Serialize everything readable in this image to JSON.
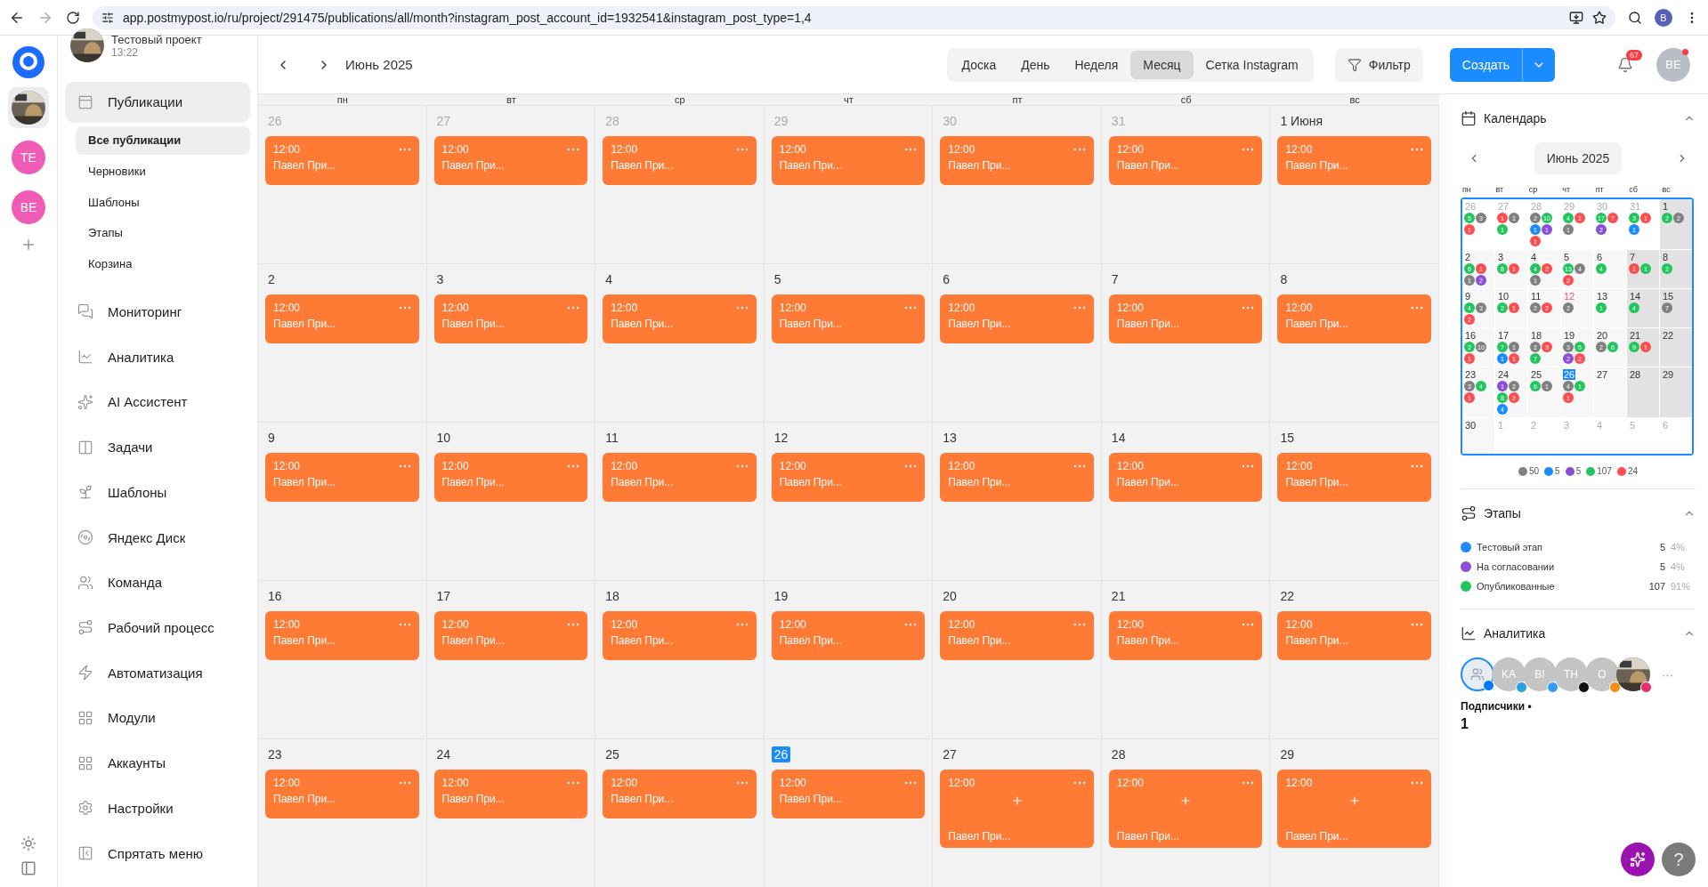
{
  "browser": {
    "url": "app.postmypost.io/ru/project/291475/publications/all/month?instagram_post_account_id=1932541&instagram_post_type=1,4",
    "profile": "B"
  },
  "rail": {
    "accounts": [
      {
        "kind": "picture",
        "selected": true
      },
      {
        "kind": "initials",
        "label": "TE",
        "selected": false
      },
      {
        "kind": "initials",
        "label": "BE",
        "selected": false
      }
    ]
  },
  "project": {
    "name": "Тестовый проект",
    "time": "13:22"
  },
  "sidebar": {
    "items": [
      {
        "label": "Публикации",
        "selected": true,
        "children": [
          {
            "label": "Все публикации",
            "selected": true
          },
          {
            "label": "Черновики",
            "selected": false
          },
          {
            "label": "Шаблоны",
            "selected": false
          },
          {
            "label": "Этапы",
            "selected": false
          },
          {
            "label": "Корзина",
            "selected": false
          }
        ]
      },
      {
        "label": "Мониторинг",
        "selected": false
      },
      {
        "label": "Аналитика",
        "selected": false
      },
      {
        "label": "AI Ассистент",
        "selected": false
      },
      {
        "label": "Задачи",
        "selected": false
      },
      {
        "label": "Шаблоны",
        "selected": false
      },
      {
        "label": "Яндекс Диск",
        "selected": false
      },
      {
        "label": "Команда",
        "selected": false
      },
      {
        "label": "Рабочий процесс",
        "selected": false
      },
      {
        "label": "Автоматизация",
        "selected": false
      },
      {
        "label": "Модули",
        "selected": false
      },
      {
        "label": "Аккаунты",
        "selected": false
      },
      {
        "label": "Настройки",
        "selected": false
      },
      {
        "label": "Спрятать меню",
        "selected": false
      }
    ]
  },
  "header": {
    "month": "Июнь 2025",
    "views": [
      {
        "label": "Доска",
        "selected": false
      },
      {
        "label": "День",
        "selected": false
      },
      {
        "label": "Неделя",
        "selected": false
      },
      {
        "label": "Месяц",
        "selected": true
      },
      {
        "label": "Сетка Instagram",
        "selected": false
      }
    ],
    "filter": "Фильтр",
    "create": "Создать",
    "notifications": "67",
    "user": "BE"
  },
  "calendar": {
    "weekdays": [
      "пн",
      "вт",
      "ср",
      "чт",
      "пт",
      "сб",
      "вс"
    ],
    "weeks": [
      [
        {
          "day": "26",
          "muted": true,
          "today": false,
          "posts": [
            {
              "time": "12:00",
              "title": "Павел При...",
              "add": false
            }
          ]
        },
        {
          "day": "27",
          "muted": true,
          "today": false,
          "posts": [
            {
              "time": "12:00",
              "title": "Павел При...",
              "add": false
            }
          ]
        },
        {
          "day": "28",
          "muted": true,
          "today": false,
          "posts": [
            {
              "time": "12:00",
              "title": "Павел При...",
              "add": false
            }
          ]
        },
        {
          "day": "29",
          "muted": true,
          "today": false,
          "posts": [
            {
              "time": "12:00",
              "title": "Павел При...",
              "add": false
            }
          ]
        },
        {
          "day": "30",
          "muted": true,
          "today": false,
          "posts": [
            {
              "time": "12:00",
              "title": "Павел При...",
              "add": false
            }
          ]
        },
        {
          "day": "31",
          "muted": true,
          "today": false,
          "posts": [
            {
              "time": "12:00",
              "title": "Павел При...",
              "add": false
            }
          ]
        },
        {
          "day": "1 Июня",
          "muted": false,
          "today": false,
          "posts": [
            {
              "time": "12:00",
              "title": "Павел При...",
              "add": false
            }
          ]
        }
      ],
      [
        {
          "day": "2",
          "muted": false,
          "today": false,
          "posts": [
            {
              "time": "12:00",
              "title": "Павел При...",
              "add": false
            }
          ]
        },
        {
          "day": "3",
          "muted": false,
          "today": false,
          "posts": [
            {
              "time": "12:00",
              "title": "Павел При...",
              "add": false
            }
          ]
        },
        {
          "day": "4",
          "muted": false,
          "today": false,
          "posts": [
            {
              "time": "12:00",
              "title": "Павел При...",
              "add": false
            }
          ]
        },
        {
          "day": "5",
          "muted": false,
          "today": false,
          "posts": [
            {
              "time": "12:00",
              "title": "Павел При...",
              "add": false
            }
          ]
        },
        {
          "day": "6",
          "muted": false,
          "today": false,
          "posts": [
            {
              "time": "12:00",
              "title": "Павел При...",
              "add": false
            }
          ]
        },
        {
          "day": "7",
          "muted": false,
          "today": false,
          "posts": [
            {
              "time": "12:00",
              "title": "Павел При...",
              "add": false
            }
          ]
        },
        {
          "day": "8",
          "muted": false,
          "today": false,
          "posts": [
            {
              "time": "12:00",
              "title": "Павел При...",
              "add": false
            }
          ]
        }
      ],
      [
        {
          "day": "9",
          "muted": false,
          "today": false,
          "posts": [
            {
              "time": "12:00",
              "title": "Павел При...",
              "add": false
            }
          ]
        },
        {
          "day": "10",
          "muted": false,
          "today": false,
          "posts": [
            {
              "time": "12:00",
              "title": "Павел При...",
              "add": false
            }
          ]
        },
        {
          "day": "11",
          "muted": false,
          "today": false,
          "posts": [
            {
              "time": "12:00",
              "title": "Павел При...",
              "add": false
            }
          ]
        },
        {
          "day": "12",
          "muted": false,
          "today": false,
          "posts": [
            {
              "time": "12:00",
              "title": "Павел При...",
              "add": false
            }
          ]
        },
        {
          "day": "13",
          "muted": false,
          "today": false,
          "posts": [
            {
              "time": "12:00",
              "title": "Павел При...",
              "add": false
            }
          ]
        },
        {
          "day": "14",
          "muted": false,
          "today": false,
          "posts": [
            {
              "time": "12:00",
              "title": "Павел При...",
              "add": false
            }
          ]
        },
        {
          "day": "15",
          "muted": false,
          "today": false,
          "posts": [
            {
              "time": "12:00",
              "title": "Павел При...",
              "add": false
            }
          ]
        }
      ],
      [
        {
          "day": "16",
          "muted": false,
          "today": false,
          "posts": [
            {
              "time": "12:00",
              "title": "Павел При...",
              "add": false
            }
          ]
        },
        {
          "day": "17",
          "muted": false,
          "today": false,
          "posts": [
            {
              "time": "12:00",
              "title": "Павел При...",
              "add": false
            }
          ]
        },
        {
          "day": "18",
          "muted": false,
          "today": false,
          "posts": [
            {
              "time": "12:00",
              "title": "Павел При...",
              "add": false
            }
          ]
        },
        {
          "day": "19",
          "muted": false,
          "today": false,
          "posts": [
            {
              "time": "12:00",
              "title": "Павел При...",
              "add": false
            }
          ]
        },
        {
          "day": "20",
          "muted": false,
          "today": false,
          "posts": [
            {
              "time": "12:00",
              "title": "Павел При...",
              "add": false
            }
          ]
        },
        {
          "day": "21",
          "muted": false,
          "today": false,
          "posts": [
            {
              "time": "12:00",
              "title": "Павел При...",
              "add": false
            }
          ]
        },
        {
          "day": "22",
          "muted": false,
          "today": false,
          "posts": [
            {
              "time": "12:00",
              "title": "Павел При...",
              "add": false
            }
          ]
        }
      ],
      [
        {
          "day": "23",
          "muted": false,
          "today": false,
          "posts": [
            {
              "time": "12:00",
              "title": "Павел При...",
              "add": false
            }
          ]
        },
        {
          "day": "24",
          "muted": false,
          "today": false,
          "posts": [
            {
              "time": "12:00",
              "title": "Павел При...",
              "add": false
            }
          ]
        },
        {
          "day": "25",
          "muted": false,
          "today": false,
          "posts": [
            {
              "time": "12:00",
              "title": "Павел При...",
              "add": false
            }
          ]
        },
        {
          "day": "26",
          "muted": false,
          "today": true,
          "posts": [
            {
              "time": "12:00",
              "title": "Павел При...",
              "add": false
            }
          ]
        },
        {
          "day": "27",
          "muted": false,
          "today": false,
          "posts": [
            {
              "time": "12:00",
              "title": "Павел При...",
              "add": true
            }
          ]
        },
        {
          "day": "28",
          "muted": false,
          "today": false,
          "posts": [
            {
              "time": "12:00",
              "title": "Павел При...",
              "add": true
            }
          ]
        },
        {
          "day": "29",
          "muted": false,
          "today": false,
          "posts": [
            {
              "time": "12:00",
              "title": "Павел При...",
              "add": true
            }
          ]
        }
      ]
    ]
  },
  "widget": {
    "title": "Календарь",
    "month": "Июнь 2025",
    "weekdays": [
      "пн",
      "вт",
      "ср",
      "чт",
      "пт",
      "сб",
      "вс"
    ],
    "weeks": [
      [
        {
          "day": "26",
          "muted": true,
          "today": false,
          "holiday": false,
          "dots": [
            {
              "color": "#22c55e",
              "count": "5"
            },
            {
              "color": "#808080",
              "count": "3"
            },
            {
              "color": "#ff4d4f",
              "count": "1"
            }
          ]
        },
        {
          "day": "27",
          "muted": true,
          "today": false,
          "holiday": false,
          "dots": [
            {
              "color": "#ff4d4f",
              "count": "1"
            },
            {
              "color": "#808080",
              "count": "1"
            },
            {
              "color": "#22c55e",
              "count": "1"
            }
          ]
        },
        {
          "day": "28",
          "muted": true,
          "today": false,
          "holiday": false,
          "dots": [
            {
              "color": "#808080",
              "count": "2"
            },
            {
              "color": "#22c55e",
              "count": "10"
            },
            {
              "color": "#1a8cff",
              "count": "1"
            },
            {
              "color": "#8a4fd8",
              "count": "1"
            },
            {
              "color": "#ff4d4f",
              "count": "1"
            }
          ]
        },
        {
          "day": "29",
          "muted": true,
          "today": false,
          "holiday": false,
          "dots": [
            {
              "color": "#22c55e",
              "count": "4"
            },
            {
              "color": "#ff4d4f",
              "count": "2"
            },
            {
              "color": "#808080",
              "count": "1"
            }
          ]
        },
        {
          "day": "30",
          "muted": true,
          "today": false,
          "holiday": false,
          "dots": [
            {
              "color": "#22c55e",
              "count": "17"
            },
            {
              "color": "#ff4d4f",
              "count": "7"
            },
            {
              "color": "#8a4fd8",
              "count": "2"
            }
          ]
        },
        {
          "day": "31",
          "muted": true,
          "today": false,
          "holiday": false,
          "dots": [
            {
              "color": "#22c55e",
              "count": "3"
            },
            {
              "color": "#ff4d4f",
              "count": "1"
            },
            {
              "color": "#1a8cff",
              "count": "1"
            }
          ]
        },
        {
          "day": "1",
          "muted": false,
          "weekend": true,
          "today": false,
          "holiday": false,
          "dots": [
            {
              "color": "#22c55e",
              "count": "2"
            },
            {
              "color": "#808080",
              "count": "2"
            }
          ]
        }
      ],
      [
        {
          "day": "2",
          "muted": false,
          "weekend": false,
          "today": false,
          "holiday": false,
          "dots": [
            {
              "color": "#22c55e",
              "count": "6"
            },
            {
              "color": "#ff4d4f",
              "count": "1"
            },
            {
              "color": "#808080",
              "count": "1"
            },
            {
              "color": "#8a4fd8",
              "count": "2"
            }
          ]
        },
        {
          "day": "3",
          "muted": false,
          "weekend": false,
          "today": false,
          "holiday": false,
          "dots": [
            {
              "color": "#22c55e",
              "count": "8"
            },
            {
              "color": "#ff4d4f",
              "count": "1"
            }
          ]
        },
        {
          "day": "4",
          "muted": false,
          "weekend": false,
          "today": false,
          "holiday": false,
          "dots": [
            {
              "color": "#22c55e",
              "count": "4"
            },
            {
              "color": "#ff4d4f",
              "count": "2"
            },
            {
              "color": "#808080",
              "count": "1"
            }
          ]
        },
        {
          "day": "5",
          "muted": false,
          "weekend": false,
          "today": false,
          "holiday": false,
          "dots": [
            {
              "color": "#22c55e",
              "count": "13"
            },
            {
              "color": "#808080",
              "count": "4"
            },
            {
              "color": "#ff4d4f",
              "count": "2"
            }
          ]
        },
        {
          "day": "6",
          "muted": false,
          "weekend": false,
          "today": false,
          "holiday": false,
          "dots": [
            {
              "color": "#22c55e",
              "count": "4"
            }
          ]
        },
        {
          "day": "7",
          "muted": false,
          "weekend": true,
          "today": false,
          "holiday": false,
          "dots": [
            {
              "color": "#ff4d4f",
              "count": "1"
            },
            {
              "color": "#22c55e",
              "count": "1"
            }
          ]
        },
        {
          "day": "8",
          "muted": false,
          "weekend": true,
          "today": false,
          "holiday": false,
          "dots": [
            {
              "color": "#22c55e",
              "count": "2"
            }
          ]
        }
      ],
      [
        {
          "day": "9",
          "muted": false,
          "weekend": false,
          "today": false,
          "holiday": false,
          "dots": [
            {
              "color": "#22c55e",
              "count": "4"
            },
            {
              "color": "#808080",
              "count": "3"
            },
            {
              "color": "#ff4d4f",
              "count": "2"
            }
          ]
        },
        {
          "day": "10",
          "muted": false,
          "weekend": false,
          "today": false,
          "holiday": false,
          "dots": [
            {
              "color": "#22c55e",
              "count": "2"
            },
            {
              "color": "#ff4d4f",
              "count": "1"
            }
          ]
        },
        {
          "day": "11",
          "muted": false,
          "weekend": false,
          "today": false,
          "holiday": false,
          "dots": [
            {
              "color": "#808080",
              "count": "2"
            },
            {
              "color": "#ff4d4f",
              "count": "2"
            }
          ]
        },
        {
          "day": "12",
          "muted": false,
          "weekend": false,
          "today": false,
          "holiday": true,
          "dots": [
            {
              "color": "#808080",
              "count": "2"
            }
          ]
        },
        {
          "day": "13",
          "muted": false,
          "weekend": false,
          "today": false,
          "holiday": false,
          "dots": [
            {
              "color": "#22c55e",
              "count": "1"
            }
          ]
        },
        {
          "day": "14",
          "muted": false,
          "weekend": true,
          "today": false,
          "holiday": false,
          "dots": [
            {
              "color": "#22c55e",
              "count": "4"
            }
          ]
        },
        {
          "day": "15",
          "muted": false,
          "weekend": true,
          "today": false,
          "holiday": false,
          "dots": [
            {
              "color": "#808080",
              "count": "7"
            }
          ]
        }
      ],
      [
        {
          "day": "16",
          "muted": false,
          "weekend": false,
          "today": false,
          "holiday": false,
          "dots": [
            {
              "color": "#22c55e",
              "count": "2"
            },
            {
              "color": "#808080",
              "count": "10"
            },
            {
              "color": "#ff4d4f",
              "count": "1"
            }
          ]
        },
        {
          "day": "17",
          "muted": false,
          "weekend": false,
          "today": false,
          "holiday": false,
          "dots": [
            {
              "color": "#22c55e",
              "count": "7"
            },
            {
              "color": "#808080",
              "count": "1"
            },
            {
              "color": "#1a8cff",
              "count": "1"
            },
            {
              "color": "#ff4d4f",
              "count": "1"
            }
          ]
        },
        {
          "day": "18",
          "muted": false,
          "weekend": false,
          "today": false,
          "holiday": false,
          "dots": [
            {
              "color": "#808080",
              "count": "2"
            },
            {
              "color": "#ff4d4f",
              "count": "3"
            },
            {
              "color": "#22c55e",
              "count": "7"
            }
          ]
        },
        {
          "day": "19",
          "muted": false,
          "weekend": false,
          "today": false,
          "holiday": false,
          "dots": [
            {
              "color": "#808080",
              "count": "3"
            },
            {
              "color": "#22c55e",
              "count": "6"
            },
            {
              "color": "#8a4fd8",
              "count": "2"
            },
            {
              "color": "#ff4d4f",
              "count": "2"
            }
          ]
        },
        {
          "day": "20",
          "muted": false,
          "weekend": false,
          "today": false,
          "holiday": false,
          "dots": [
            {
              "color": "#808080",
              "count": "2"
            },
            {
              "color": "#22c55e",
              "count": "6"
            }
          ]
        },
        {
          "day": "21",
          "muted": false,
          "weekend": true,
          "today": false,
          "holiday": false,
          "dots": [
            {
              "color": "#22c55e",
              "count": "9"
            },
            {
              "color": "#ff4d4f",
              "count": "1"
            }
          ]
        },
        {
          "day": "22",
          "muted": false,
          "weekend": true,
          "today": false,
          "holiday": false
        }
      ],
      [
        {
          "day": "23",
          "muted": false,
          "weekend": false,
          "today": false,
          "holiday": false,
          "dots": [
            {
              "color": "#808080",
              "count": "3"
            },
            {
              "color": "#22c55e",
              "count": "4"
            },
            {
              "color": "#ff4d4f",
              "count": "1"
            }
          ]
        },
        {
          "day": "24",
          "muted": false,
          "weekend": false,
          "today": false,
          "holiday": false,
          "dots": [
            {
              "color": "#8a4fd8",
              "count": "1"
            },
            {
              "color": "#808080",
              "count": "2"
            },
            {
              "color": "#22c55e",
              "count": "8"
            },
            {
              "color": "#ff4d4f",
              "count": "2"
            },
            {
              "color": "#1a8cff",
              "count": "4"
            }
          ]
        },
        {
          "day": "25",
          "muted": false,
          "weekend": false,
          "today": false,
          "holiday": false,
          "dots": [
            {
              "color": "#22c55e",
              "count": "6"
            },
            {
              "color": "#808080",
              "count": "1"
            }
          ]
        },
        {
          "day": "26",
          "muted": false,
          "weekend": false,
          "today": true,
          "holiday": false,
          "dots": [
            {
              "color": "#808080",
              "count": "4"
            },
            {
              "color": "#22c55e",
              "count": "1"
            },
            {
              "color": "#ff4d4f",
              "count": "1"
            }
          ]
        },
        {
          "day": "27",
          "muted": false,
          "weekend": false,
          "today": false,
          "holiday": false
        },
        {
          "day": "28",
          "muted": false,
          "weekend": true,
          "today": false,
          "holiday": false
        },
        {
          "day": "29",
          "muted": false,
          "weekend": true,
          "today": false,
          "holiday": false
        }
      ],
      [
        {
          "day": "30",
          "muted": false,
          "weekend": false,
          "today": false,
          "holiday": false
        },
        {
          "day": "1",
          "muted": true,
          "today": false,
          "holiday": false
        },
        {
          "day": "2",
          "muted": true,
          "today": false,
          "holiday": false
        },
        {
          "day": "3",
          "muted": true,
          "today": false,
          "holiday": false
        },
        {
          "day": "4",
          "muted": true,
          "today": false,
          "holiday": false
        },
        {
          "day": "5",
          "muted": true,
          "today": false,
          "holiday": false
        },
        {
          "day": "6",
          "muted": true,
          "today": false,
          "holiday": false
        }
      ]
    ],
    "legend": [
      {
        "color": "#808080",
        "count": "50"
      },
      {
        "color": "#1a8cff",
        "count": "5"
      },
      {
        "color": "#8a4fd8",
        "count": "5"
      },
      {
        "color": "#22c55e",
        "count": "107"
      },
      {
        "color": "#ff4d4f",
        "count": "24"
      }
    ]
  },
  "stages": {
    "title": "Этапы",
    "items": [
      {
        "name": "Тестовый этап",
        "color": "#1a8cff",
        "count": "5",
        "percent": "4%"
      },
      {
        "name": "На согласовании",
        "color": "#8a4fd8",
        "count": "5",
        "percent": "4%"
      },
      {
        "name": "Опубликованные",
        "color": "#22c55e",
        "count": "107",
        "percent": "91%"
      }
    ]
  },
  "analytics": {
    "title": "Аналитика",
    "accounts": [
      {
        "kind": "placeholder",
        "selected": true,
        "color": "#0077ff"
      },
      {
        "kind": "initials",
        "label": "KA",
        "selected": false,
        "color": "#2aa3dd"
      },
      {
        "kind": "initials",
        "label": "BI",
        "selected": false,
        "color": "#3b9cf5"
      },
      {
        "kind": "initials",
        "label": "TH",
        "selected": false,
        "color": "#111111"
      },
      {
        "kind": "initials",
        "label": "O",
        "selected": false,
        "color": "#f28c1a"
      },
      {
        "kind": "picture",
        "selected": false,
        "color": "#e1306c"
      }
    ],
    "more": "···",
    "metric": "Подписчики •",
    "value": "1"
  },
  "help": "?"
}
